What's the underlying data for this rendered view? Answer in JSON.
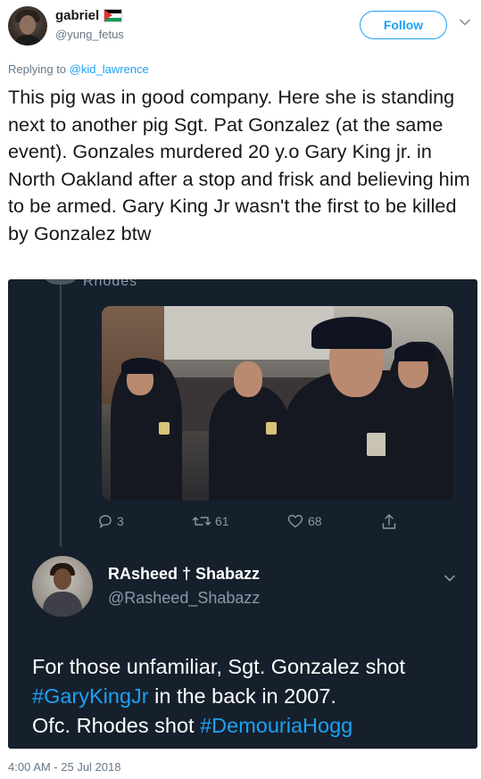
{
  "author": {
    "display_name": "gabriel",
    "handle": "@yung_fetus",
    "flag_icon": "palestine-flag-icon"
  },
  "follow_button": {
    "label": "Follow"
  },
  "reply": {
    "prefix": "Replying to",
    "mention": "@kid_lawrence"
  },
  "tweet": {
    "text": "This pig was in good company. Here she is standing next to another pig Sgt. Pat Gonzalez (at the same event). Gonzales murdered 20 y.o Gary King jr. in North Oakland after a stop and frisk and believing him to be armed. Gary King Jr wasn't the first to be killed by Gonzalez btw"
  },
  "media": {
    "top_cut_text": "Rhodes",
    "actions": {
      "reply_count": "3",
      "retweet_count": "61",
      "like_count": "68"
    },
    "quoted": {
      "name": "RAsheed † Shabazz",
      "handle": "@Rasheed_Shabazz",
      "text_part1": "For those unfamiliar, Sgt. Gonzalez shot",
      "hashtag1": "#GaryKingJr",
      "text_part2": " in the back in 2007.",
      "text_part3": "Ofc. Rhodes shot ",
      "hashtag2": "#DemouriaHogg"
    }
  },
  "timestamp": "4:00 AM - 25 Jul 2018",
  "colors": {
    "accent": "#1da1f2",
    "secondary_text": "#657786",
    "dark_bg": "#16202c"
  }
}
